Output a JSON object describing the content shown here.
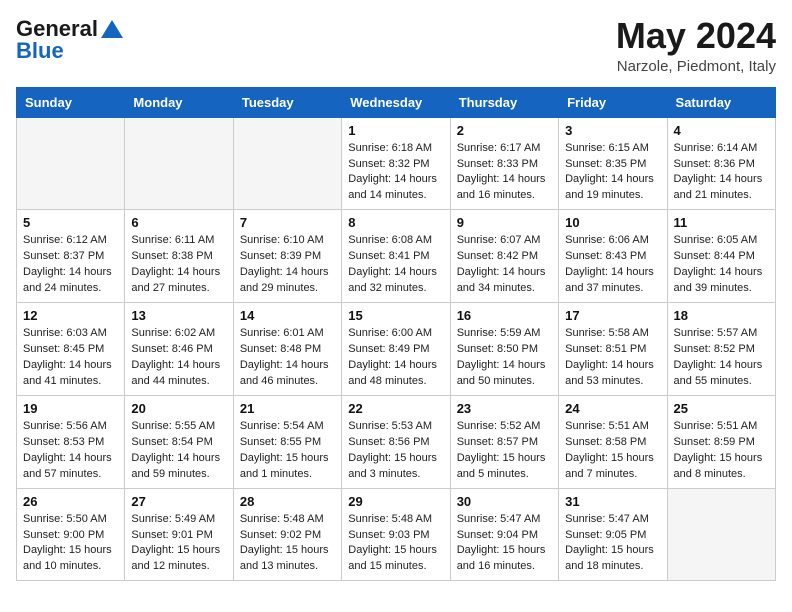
{
  "header": {
    "logo_general": "General",
    "logo_blue": "Blue",
    "month_title": "May 2024",
    "location": "Narzole, Piedmont, Italy"
  },
  "days_of_week": [
    "Sunday",
    "Monday",
    "Tuesday",
    "Wednesday",
    "Thursday",
    "Friday",
    "Saturday"
  ],
  "weeks": [
    [
      {
        "day": "",
        "info": ""
      },
      {
        "day": "",
        "info": ""
      },
      {
        "day": "",
        "info": ""
      },
      {
        "day": "1",
        "info": "Sunrise: 6:18 AM\nSunset: 8:32 PM\nDaylight: 14 hours\nand 14 minutes."
      },
      {
        "day": "2",
        "info": "Sunrise: 6:17 AM\nSunset: 8:33 PM\nDaylight: 14 hours\nand 16 minutes."
      },
      {
        "day": "3",
        "info": "Sunrise: 6:15 AM\nSunset: 8:35 PM\nDaylight: 14 hours\nand 19 minutes."
      },
      {
        "day": "4",
        "info": "Sunrise: 6:14 AM\nSunset: 8:36 PM\nDaylight: 14 hours\nand 21 minutes."
      }
    ],
    [
      {
        "day": "5",
        "info": "Sunrise: 6:12 AM\nSunset: 8:37 PM\nDaylight: 14 hours\nand 24 minutes."
      },
      {
        "day": "6",
        "info": "Sunrise: 6:11 AM\nSunset: 8:38 PM\nDaylight: 14 hours\nand 27 minutes."
      },
      {
        "day": "7",
        "info": "Sunrise: 6:10 AM\nSunset: 8:39 PM\nDaylight: 14 hours\nand 29 minutes."
      },
      {
        "day": "8",
        "info": "Sunrise: 6:08 AM\nSunset: 8:41 PM\nDaylight: 14 hours\nand 32 minutes."
      },
      {
        "day": "9",
        "info": "Sunrise: 6:07 AM\nSunset: 8:42 PM\nDaylight: 14 hours\nand 34 minutes."
      },
      {
        "day": "10",
        "info": "Sunrise: 6:06 AM\nSunset: 8:43 PM\nDaylight: 14 hours\nand 37 minutes."
      },
      {
        "day": "11",
        "info": "Sunrise: 6:05 AM\nSunset: 8:44 PM\nDaylight: 14 hours\nand 39 minutes."
      }
    ],
    [
      {
        "day": "12",
        "info": "Sunrise: 6:03 AM\nSunset: 8:45 PM\nDaylight: 14 hours\nand 41 minutes."
      },
      {
        "day": "13",
        "info": "Sunrise: 6:02 AM\nSunset: 8:46 PM\nDaylight: 14 hours\nand 44 minutes."
      },
      {
        "day": "14",
        "info": "Sunrise: 6:01 AM\nSunset: 8:48 PM\nDaylight: 14 hours\nand 46 minutes."
      },
      {
        "day": "15",
        "info": "Sunrise: 6:00 AM\nSunset: 8:49 PM\nDaylight: 14 hours\nand 48 minutes."
      },
      {
        "day": "16",
        "info": "Sunrise: 5:59 AM\nSunset: 8:50 PM\nDaylight: 14 hours\nand 50 minutes."
      },
      {
        "day": "17",
        "info": "Sunrise: 5:58 AM\nSunset: 8:51 PM\nDaylight: 14 hours\nand 53 minutes."
      },
      {
        "day": "18",
        "info": "Sunrise: 5:57 AM\nSunset: 8:52 PM\nDaylight: 14 hours\nand 55 minutes."
      }
    ],
    [
      {
        "day": "19",
        "info": "Sunrise: 5:56 AM\nSunset: 8:53 PM\nDaylight: 14 hours\nand 57 minutes."
      },
      {
        "day": "20",
        "info": "Sunrise: 5:55 AM\nSunset: 8:54 PM\nDaylight: 14 hours\nand 59 minutes."
      },
      {
        "day": "21",
        "info": "Sunrise: 5:54 AM\nSunset: 8:55 PM\nDaylight: 15 hours\nand 1 minutes."
      },
      {
        "day": "22",
        "info": "Sunrise: 5:53 AM\nSunset: 8:56 PM\nDaylight: 15 hours\nand 3 minutes."
      },
      {
        "day": "23",
        "info": "Sunrise: 5:52 AM\nSunset: 8:57 PM\nDaylight: 15 hours\nand 5 minutes."
      },
      {
        "day": "24",
        "info": "Sunrise: 5:51 AM\nSunset: 8:58 PM\nDaylight: 15 hours\nand 7 minutes."
      },
      {
        "day": "25",
        "info": "Sunrise: 5:51 AM\nSunset: 8:59 PM\nDaylight: 15 hours\nand 8 minutes."
      }
    ],
    [
      {
        "day": "26",
        "info": "Sunrise: 5:50 AM\nSunset: 9:00 PM\nDaylight: 15 hours\nand 10 minutes."
      },
      {
        "day": "27",
        "info": "Sunrise: 5:49 AM\nSunset: 9:01 PM\nDaylight: 15 hours\nand 12 minutes."
      },
      {
        "day": "28",
        "info": "Sunrise: 5:48 AM\nSunset: 9:02 PM\nDaylight: 15 hours\nand 13 minutes."
      },
      {
        "day": "29",
        "info": "Sunrise: 5:48 AM\nSunset: 9:03 PM\nDaylight: 15 hours\nand 15 minutes."
      },
      {
        "day": "30",
        "info": "Sunrise: 5:47 AM\nSunset: 9:04 PM\nDaylight: 15 hours\nand 16 minutes."
      },
      {
        "day": "31",
        "info": "Sunrise: 5:47 AM\nSunset: 9:05 PM\nDaylight: 15 hours\nand 18 minutes."
      },
      {
        "day": "",
        "info": ""
      }
    ]
  ]
}
